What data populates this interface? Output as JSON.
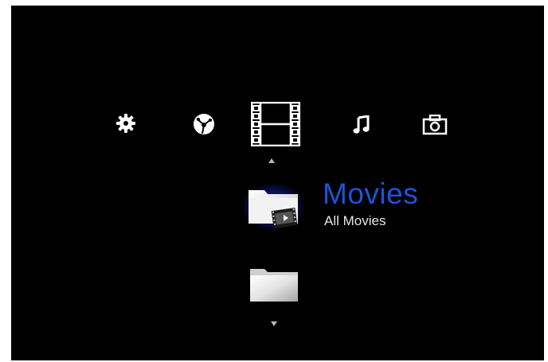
{
  "menu": {
    "categories": [
      {
        "name": "settings",
        "icon": "gear-icon"
      },
      {
        "name": "internet",
        "icon": "globe-icon"
      },
      {
        "name": "video",
        "icon": "film-strip-icon",
        "selected": true
      },
      {
        "name": "music",
        "icon": "music-note-icon"
      },
      {
        "name": "photo",
        "icon": "camera-icon"
      }
    ]
  },
  "list": {
    "selected": {
      "title": "Movies",
      "subtitle": "All Movies",
      "icon": "movie-folder-icon"
    },
    "next": {
      "icon": "folder-icon"
    }
  },
  "colors": {
    "background": "#000000",
    "accent": "#1d54d8",
    "text": "#e6e6e6"
  }
}
